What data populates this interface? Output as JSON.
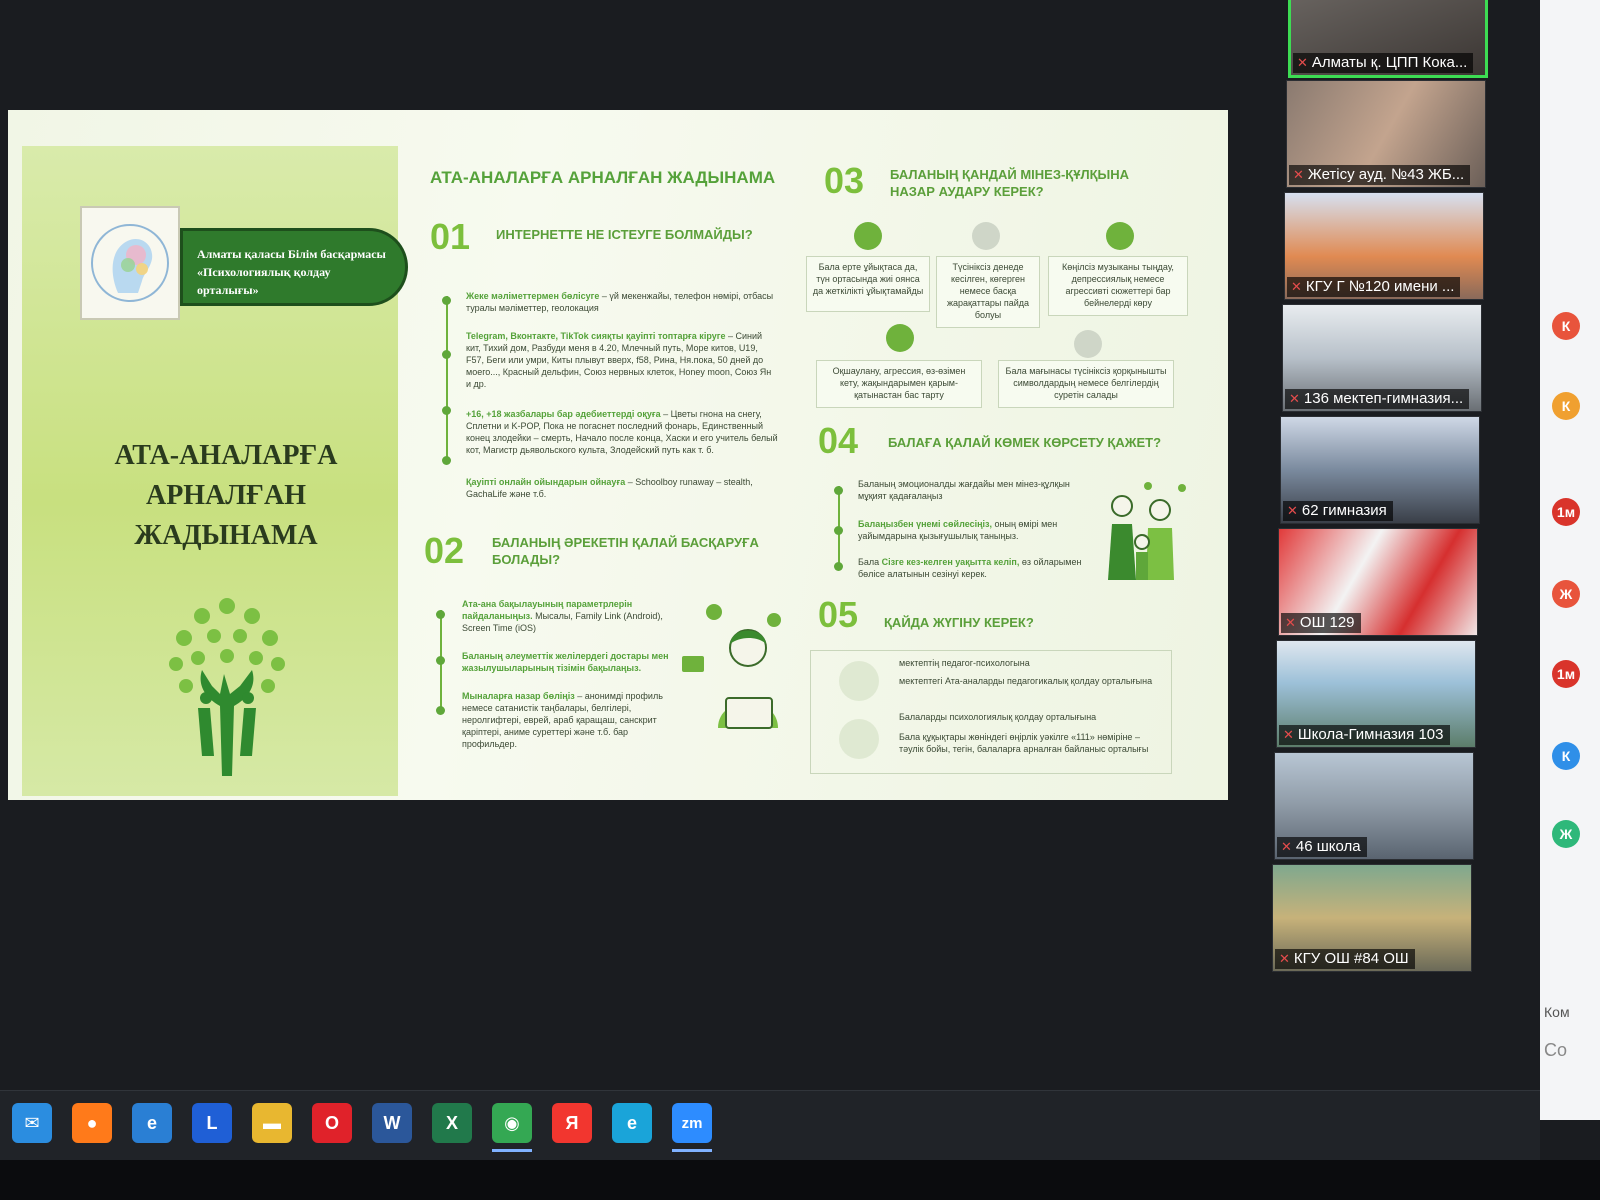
{
  "slide": {
    "logo_caption": "",
    "banner_line1": "Алматы қаласы Білім басқармасы",
    "banner_line2": "«Психологиялық қолдау орталығы»",
    "cover_title_lines": [
      "АТА-АНАЛАРҒА",
      "АРНАЛҒАН",
      "ЖАДЫНАМА"
    ],
    "main_heading": "АТА-АНАЛАРҒА АРНАЛҒАН ЖАДЫНАМА",
    "sections": [
      {
        "num": "01",
        "title": "ИНТЕРНЕТТЕ НЕ ІСТЕУГЕ БОЛМАЙДЫ?"
      },
      {
        "num": "02",
        "title_line1": "БАЛАНЫҢ ӘРЕКЕТІН ҚАЛАЙ БАСҚАРУҒА",
        "title_line2": "БОЛАДЫ?"
      },
      {
        "num": "03",
        "title_line1": "БАЛАНЫҢ ҚАНДАЙ МІНЕЗ-ҚҰЛҚЫНА",
        "title_line2": "НАЗАР АУДАРУ КЕРЕК?"
      },
      {
        "num": "04",
        "title": "БАЛАҒА ҚАЛАЙ КӨМЕК КӨРСЕТУ ҚАЖЕТ?"
      },
      {
        "num": "05",
        "title": "ҚАЙДА ЖҮГІНУ КЕРЕК?"
      }
    ],
    "s01_items": [
      {
        "hl": "Жеке мәліметтермен бөлісуге",
        "text": " – үй мекенжайы, телефон нөмірі, отбасы туралы мәліметтер, геолокация"
      },
      {
        "hl": "Telegram, Вконтакте, TikTok сияқты қауіпті топтарға кіруге",
        "text": " – Синий кит, Тихий дом, Разбуди меня в 4.20, Млечный путь, Море китов, U19, F57, Беги или умри, Киты плывут вверх, f58, Рина, Ня.пока, 50 дней до моего..., Красный дельфин, Союз нервных клеток, Honey moon, Союз Ян и др."
      },
      {
        "hl": "+16, +18 жазбалары бар әдебиеттерді оқуға",
        "text": " – Цветы гнона на снегу, Сплетни и K-POP, Пока не погаснет последний фонарь, Единственный конец злодейки – смерть, Начало после конца, Хаски и его учитель белый кот, Магистр дьявольского культа, Злодейский путь как т. б."
      },
      {
        "hl": "Қауіпті онлайн ойындарын ойнауға",
        "text": " – Schoolboy runaway – stealth, GachaLife және т.б."
      }
    ],
    "s02_items": [
      {
        "hl": "Ата-ана бақылауының параметрлерін пайдаланыңыз.",
        "text": " Мысалы, Family Link (Android), Screen Time (iOS)"
      },
      {
        "hl": "Баланың әлеуметтік желілердегі достары мен жазылушыларының тізімін бақылаңыз.",
        "text": ""
      },
      {
        "hl": "Мыналарға назар бөліңіз",
        "text": " – анонимді профиль немесе сатанистік таңбалары, белгілері, неролгифтері, еврей, араб қаращаш, санскрит қарiптерi, аниме суреттері және т.б. бар профильдер."
      }
    ],
    "s03_cards": [
      "Бала ерте ұйықтаса да, түн ортасында жиі оянса да жеткілікті ұйықтамайды",
      "Түсініксіз денеде кесілген, көгерген немесе басқа жарақаттары пайда болуы",
      "Көңілсіз музыканы тыңдау, депрессиялық немесе агрессивті сюжеттері бар бейнелерді көру",
      "Оқшаулану, агрессия, өз-өзімен кету, жақындарымен қарым-қатынастан бас тарту",
      "Бала мағынасы түсініксіз қорқынышты символдардың немесе белгілердің суретін салады"
    ],
    "s04_items": [
      {
        "hl": "",
        "pre": "Баланың эмоционалды жағдайы мен мінез-құлқын мұқият қадағалаңыз",
        "text": ""
      },
      {
        "hl": "Балаңызбен үнемі сөйлесіңіз,",
        "pre": "",
        "text": " оның өмірі мен уайымдарына қызығушылық таныңыз."
      },
      {
        "hl": "Сізге кез-келген уақытта келіп,",
        "pre": "Бала ",
        "text": " өз ойларымен бөлісе алатынын сезінуі керек."
      }
    ],
    "s05_items": [
      "мектептің педагог-психологына",
      "мектептегі Ата-аналарды педагогикалық қолдау орталығына",
      "Балаларды психологиялық қолдау орталығына",
      "Бала құқықтары жөніндегі өңірлік уәкілге «111» нөміріне – тәулік бойы, тегін, балаларға арналған байланыс орталығы"
    ]
  },
  "participants": [
    {
      "name": "Алматы қ. ЦПП Кока...",
      "active": true
    },
    {
      "name": "Жетісу ауд. №43 ЖБ..."
    },
    {
      "name": "КГУ Г №120 имени ..."
    },
    {
      "name": "136 мектеп-гимназия..."
    },
    {
      "name": "62 гимназия"
    },
    {
      "name": "ОШ 129"
    },
    {
      "name": "Школа-Гимназия 103"
    },
    {
      "name": "46 школа"
    },
    {
      "name": "КГУ ОШ #84 ОШ"
    }
  ],
  "side_strip": {
    "chips": [
      {
        "letter": "К",
        "color": "#e8543c"
      },
      {
        "letter": "К",
        "color": "#f0a030"
      },
      {
        "letter": "1м",
        "color": "#d9342b"
      },
      {
        "letter": "Ж",
        "color": "#e8543c"
      },
      {
        "letter": "1м",
        "color": "#d9342b"
      },
      {
        "letter": "К",
        "color": "#2f8fe8"
      },
      {
        "letter": "Ж",
        "color": "#2eb87a"
      }
    ],
    "text1": "Ком",
    "text2": "Со"
  },
  "taskbar": {
    "apps": [
      {
        "name": "mail-icon",
        "glyph": "✉",
        "color": "#2b8de0"
      },
      {
        "name": "firefox-icon",
        "glyph": "●",
        "color": "#ff7a1a"
      },
      {
        "name": "internet-explorer-icon",
        "glyph": "e",
        "color": "#2a7fd4"
      },
      {
        "name": "lingvo-icon",
        "glyph": "L",
        "color": "#1f5fd6"
      },
      {
        "name": "file-explorer-icon",
        "glyph": "▬",
        "color": "#e8b730"
      },
      {
        "name": "opera-icon",
        "glyph": "O",
        "color": "#e0222a"
      },
      {
        "name": "word-icon",
        "glyph": "W",
        "color": "#2b579a"
      },
      {
        "name": "excel-icon",
        "glyph": "X",
        "color": "#21794b"
      },
      {
        "name": "chrome-icon",
        "glyph": "◉",
        "color": "#34a853"
      },
      {
        "name": "yandex-icon",
        "glyph": "Я",
        "color": "#f2362f"
      },
      {
        "name": "edge-icon",
        "glyph": "e",
        "color": "#1aa4d9"
      },
      {
        "name": "zoom-icon",
        "glyph": "zm",
        "color": "#2d8cff"
      }
    ]
  },
  "colors": {
    "accent_green": "#55a23a",
    "active_border": "#3ddc53",
    "mic_muted": "#e44c4c"
  }
}
